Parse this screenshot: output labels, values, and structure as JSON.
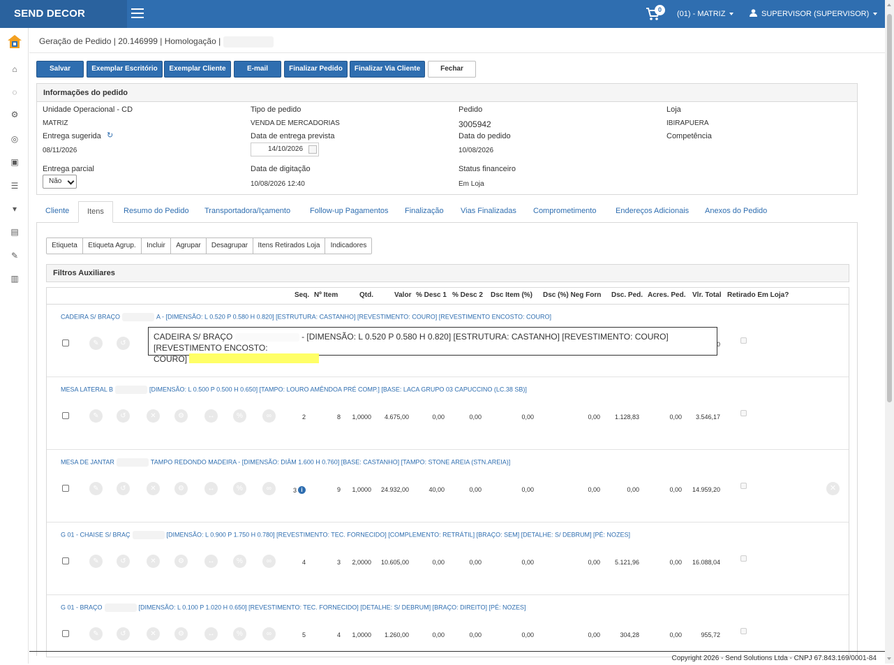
{
  "app": {
    "brand": "SEND DECOR",
    "store": "(01) - MATRIZ",
    "user": "SUPERVISOR (SUPERVISOR)",
    "cart_count": "0"
  },
  "header": {
    "title": "Geração de Pedido | 20.146999 | Homologação |"
  },
  "toolbar": {
    "buttons": [
      "Salvar",
      "Exemplar Escritório",
      "Exemplar Cliente",
      "E-mail",
      "Finalizar Pedido",
      "Finalizar Via Cliente",
      "Fechar"
    ]
  },
  "info": {
    "title": "Informações do pedido",
    "unidade_label": "Unidade Operacional - CD",
    "unidade_value": "MATRIZ",
    "tipo_label": "Tipo de pedido",
    "tipo_value": "VENDA DE MERCADORIAS",
    "pedido_label": "Pedido",
    "pedido_value": "3005942",
    "loja_label": "Loja",
    "loja_value": "IBIRAPUERA",
    "entrega_sugerida_label": "Entrega sugerida",
    "entrega_sugerida_value": "08/11/2026",
    "data_entrega_label": "Data de entrega prevista",
    "data_entrega_value": "14/10/2026",
    "data_pedido_label": "Data do pedido",
    "data_pedido_value": "10/08/2026",
    "competencia_label": "Competência",
    "entrega_parcial_label": "Entrega parcial",
    "entrega_parcial_value": "Não",
    "data_digitacao_label": "Data de digitação",
    "data_digitacao_value": "10/08/2026 12:40",
    "status_fin_label": "Status financeiro",
    "status_fin_value": "Em Loja"
  },
  "tabs": [
    "Cliente",
    "Itens",
    "Resumo do Pedido",
    "Transportadora/Içamento",
    "Follow-up Pagamentos",
    "Finalização",
    "Vias Finalizadas",
    "Comprometimento",
    "Endereços Adicionais",
    "Anexos do Pedido"
  ],
  "subtoolbar": [
    "Etiqueta",
    "Etiqueta Agrup.",
    "Incluir",
    "Agrupar",
    "Desagrupar",
    "Itens Retirados Loja",
    "Indicadores"
  ],
  "filters_title": "Filtros Auxiliares",
  "columns": [
    "Seq.",
    "Nº Item",
    "Qtd.",
    "Valor",
    "% Desc 1",
    "% Desc 2",
    "Dsc Item (%)",
    "Dsc (%) Neg Forn",
    "Dsc. Ped.",
    "Acres. Ped.",
    "Vlr. Total",
    "Retirado Em Loja?"
  ],
  "rows": [
    {
      "desc_a": "CADEIRA S/ BRAÇO",
      "desc_b": "A - [DIMENSÃO: L 0.520 P 0.580 H 0.820] [ESTRUTURA: CASTANHO] [REVESTIMENTO: COURO] [REVESTIMENTO ENCOSTO: COURO]",
      "seq": "",
      "item": "",
      "qtd": "",
      "valor": "",
      "d1": "",
      "d2": "",
      "dsc_item": "",
      "dsc_neg": "",
      "dsc_ped": "",
      "acres": "",
      "total": "0"
    },
    {
      "desc_a": "MESA LATERAL B",
      "desc_b": "[DIMENSÃO: L 0.500 P 0.500 H 0.650] [TAMPO: LOURO AMÊNDOA PRÉ COMP.] [BASE: LACA GRUPO 03 CAPUCCINO (LC.38 SB)]",
      "seq": "2",
      "item": "8",
      "qtd": "1,0000",
      "valor": "4.675,00",
      "d1": "0,00",
      "d2": "0,00",
      "dsc_item": "0,00",
      "dsc_neg": "0,00",
      "dsc_ped": "1.128,83",
      "acres": "0,00",
      "total": "3.546,17"
    },
    {
      "desc_a": "MESA DE JANTAR",
      "desc_b": "TAMPO REDONDO MADEIRA - [DIMENSÃO: DIÂM 1.600 H 0.760] [BASE: CASTANHO] [TAMPO: STONE AREIA (STN.AREIA)]",
      "seq": "3",
      "item": "9",
      "qtd": "1,0000",
      "valor": "24.932,00",
      "d1": "40,00",
      "d2": "0,00",
      "dsc_item": "0,00",
      "dsc_neg": "0,00",
      "dsc_ped": "0,00",
      "acres": "0,00",
      "total": "14.959,20"
    },
    {
      "desc_a": "G 01 - CHAISE S/ BRAÇ",
      "desc_b": "[DIMENSÃO: L 0.900 P 1.750 H 0.780] [REVESTIMENTO: TEC. FORNECIDO] [COMPLEMENTO: RETRÁTIL] [BRAÇO: SEM] [DETALHE: S/ DEBRUM] [PÉ: NOZES]",
      "seq": "4",
      "item": "3",
      "qtd": "2,0000",
      "valor": "10.605,00",
      "d1": "0,00",
      "d2": "0,00",
      "dsc_item": "0,00",
      "dsc_neg": "0,00",
      "dsc_ped": "5.121,96",
      "acres": "0,00",
      "total": "16.088,04"
    },
    {
      "desc_a": "G 01 - BRAÇO",
      "desc_b": "[DIMENSÃO: L 0.100 P 1.020 H 0.650] [REVESTIMENTO: TEC. FORNECIDO] [DETALHE: S/ DEBRUM] [BRAÇO: DIREITO] [PÉ: NOZES]",
      "seq": "5",
      "item": "4",
      "qtd": "1,0000",
      "valor": "1.260,00",
      "d1": "0,00",
      "d2": "0,00",
      "dsc_item": "0,00",
      "dsc_neg": "0,00",
      "dsc_ped": "304,28",
      "acres": "0,00",
      "total": "955,72"
    }
  ],
  "tooltip": {
    "line1": "CADEIRA S/ BRAÇO",
    "line2": "- [DIMENSÃO: L 0.520 P 0.580 H 0.820] [ESTRUTURA: CASTANHO] [REVESTIMENTO: COURO] [REVESTIMENTO ENCOSTO:",
    "line3": "COURO]"
  },
  "footer": "Copyright 2026 - Send Solutions Ltda - CNPJ 67.843.169/0001-84",
  "colors": {
    "primary": "#2f6eb0",
    "link": "#2f6eb0",
    "highlight": "#ffff66"
  }
}
